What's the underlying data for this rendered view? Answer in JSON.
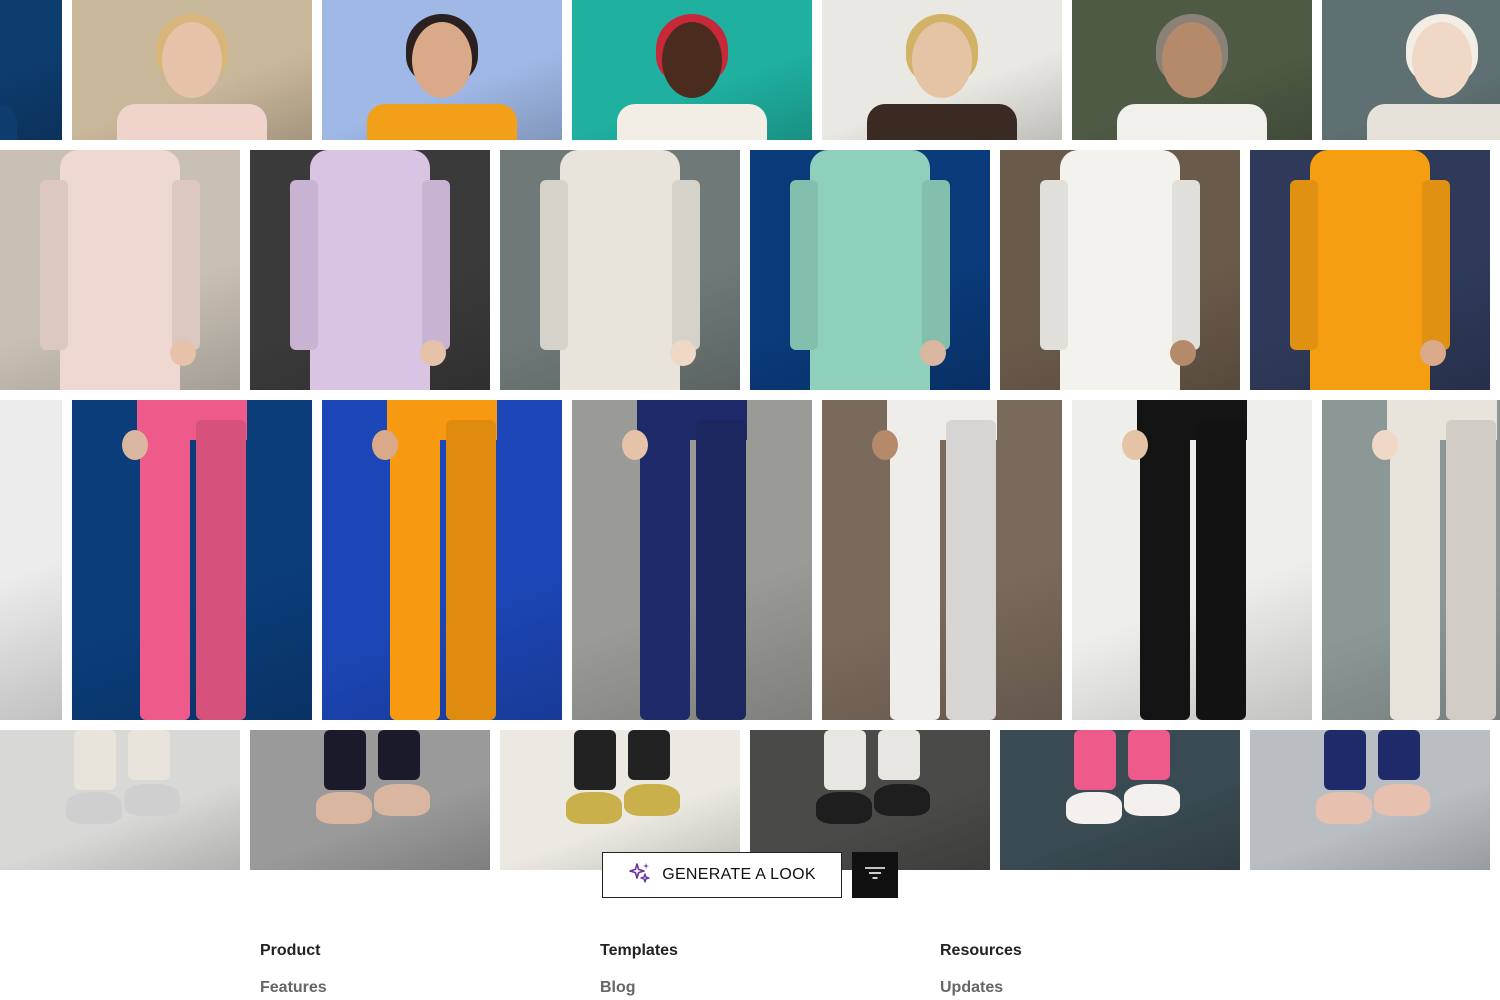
{
  "toolbar": {
    "generate_label": "GENERATE A LOOK",
    "generate_icon": "sparkles-icon",
    "filter_icon": "filter-icon",
    "accent_color": "#6b2fa0"
  },
  "footer": {
    "columns": [
      {
        "heading": "Product",
        "first_link": "Features"
      },
      {
        "heading": "Templates",
        "first_link": "Blog"
      },
      {
        "heading": "Resources",
        "first_link": "Updates"
      }
    ]
  },
  "gallery": {
    "rows": [
      {
        "section": "heads",
        "tiles": [
          {
            "bg": "#0d3c6e",
            "accent": "#0d3c6e",
            "skin": "#d9b6a0"
          },
          {
            "bg": "#c9b79a",
            "accent": "#f0d4cc",
            "skin": "#e6c2a8",
            "hair": "#d8b57a"
          },
          {
            "bg": "#9fb8e6",
            "accent": "#f2a01a",
            "skin": "#d9a98a",
            "hair": "#2a2020"
          },
          {
            "bg": "#1fb0a0",
            "accent": "#f2eee6",
            "skin": "#4a2c1e",
            "hair": "#c7283a"
          },
          {
            "bg": "#e9e8e2",
            "accent": "#3b2a22",
            "skin": "#e4c4a4",
            "hair": "#d2b266"
          },
          {
            "bg": "#4e5a44",
            "accent": "#f2f0ea",
            "skin": "#b58a6a",
            "hair": "#8a8278"
          },
          {
            "bg": "#5f7072",
            "accent": "#e6e2da",
            "skin": "#efd9c6",
            "hair": "#f2eee6"
          }
        ]
      },
      {
        "section": "torsos",
        "tiles": [
          {
            "bg": "#c8c0b4",
            "accent": "#f0d8d2",
            "skin": "#e6c2a8"
          },
          {
            "bg": "#3a3a3a",
            "accent": "#d9c4e4",
            "skin": "#e6c2a8"
          },
          {
            "bg": "#6f7a78",
            "accent": "#e8e4dc",
            "skin": "#efd9c6"
          },
          {
            "bg": "#0a3a7a",
            "accent": "#8fd0bc",
            "skin": "#d9b6a0"
          },
          {
            "bg": "#6a5a4a",
            "accent": "#f4f2ec",
            "skin": "#b58a6a"
          },
          {
            "bg": "#2f3a5a",
            "accent": "#f59e12",
            "skin": "#d9a98a"
          },
          {
            "bg": "#22b2a2",
            "accent": "#eeeae2",
            "skin": "#4a2c1e"
          }
        ]
      },
      {
        "section": "legs",
        "tiles": [
          {
            "bg": "#ececec",
            "accent": "#f4f2ee",
            "skin": "#4a2c1e"
          },
          {
            "bg": "#0b3d7a",
            "accent": "#ee5a8a",
            "skin": "#d9b6a0"
          },
          {
            "bg": "#1d47b8",
            "accent": "#f79a12",
            "skin": "#d9a98a"
          },
          {
            "bg": "#9a9a96",
            "accent": "#1f2a6a",
            "skin": "#e6c2a8"
          },
          {
            "bg": "#7a6a5c",
            "accent": "#efedea",
            "skin": "#b58a6a"
          },
          {
            "bg": "#eeeeea",
            "accent": "#141414",
            "skin": "#e4c4a4"
          },
          {
            "bg": "#8c9896",
            "accent": "#e8e4dc",
            "skin": "#efd9c6"
          }
        ]
      },
      {
        "section": "feet",
        "tiles": [
          {
            "bg": "#d8d8d6",
            "accent": "#e8e4dc",
            "skin": "#cfcfcf"
          },
          {
            "bg": "#9a9a9a",
            "accent": "#1a1a2a",
            "skin": "#d9b6a0"
          },
          {
            "bg": "#ebe9e2",
            "accent": "#222222",
            "skin": "#c9b04a"
          },
          {
            "bg": "#4a4a48",
            "accent": "#e8e6e0",
            "skin": "#1e1e1e"
          },
          {
            "bg": "#3a4a52",
            "accent": "#ee5a8a",
            "skin": "#f4f0ee"
          },
          {
            "bg": "#b9bec2",
            "accent": "#1f2a6a",
            "skin": "#e8c0b0"
          },
          {
            "bg": "#1a2a4a",
            "accent": "#f79a12",
            "skin": "#d9a98a"
          }
        ]
      }
    ]
  }
}
